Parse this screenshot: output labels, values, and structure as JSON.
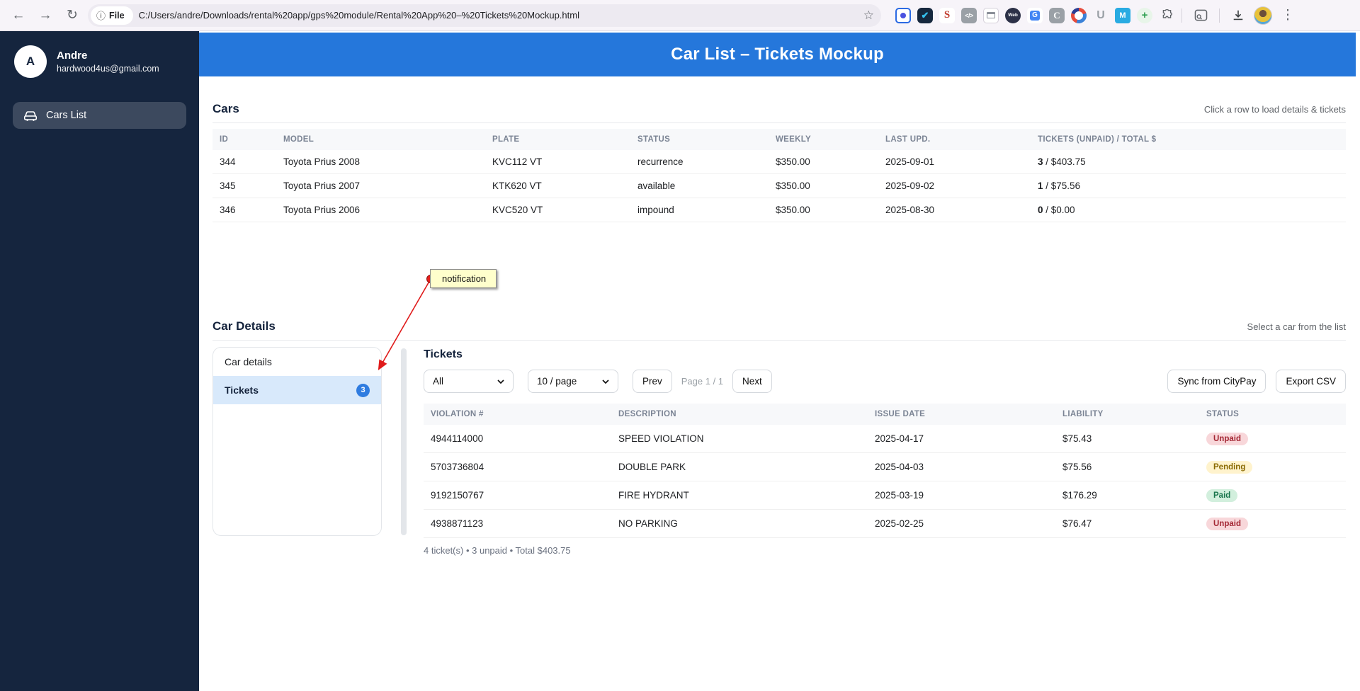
{
  "browser": {
    "scheme_chip": "File",
    "url": "C:/Users/andre/Downloads/rental%20app/gps%20module/Rental%20App%20–%20Tickets%20Mockup.html",
    "extensions": [
      {
        "name": "tab-capture-icon",
        "glyph": ""
      },
      {
        "name": "todo-check-icon",
        "glyph": "✔"
      },
      {
        "name": "seo-icon",
        "glyph": "S"
      },
      {
        "name": "code-icon",
        "glyph": "</>"
      },
      {
        "name": "screenshot-icon",
        "glyph": ""
      },
      {
        "name": "web-badge-icon",
        "glyph": "Web"
      },
      {
        "name": "translate-icon",
        "glyph": "G"
      },
      {
        "name": "c-icon",
        "glyph": "C"
      },
      {
        "name": "ring-icon",
        "glyph": ""
      },
      {
        "name": "u-icon",
        "glyph": "U"
      },
      {
        "name": "m-icon",
        "glyph": "M"
      },
      {
        "name": "plus-icon",
        "glyph": "+"
      },
      {
        "name": "puzzle-icon",
        "glyph": ""
      }
    ]
  },
  "sidebar": {
    "user": {
      "initial": "A",
      "name": "Andre",
      "email": "hardwood4us@gmail.com"
    },
    "items": [
      {
        "label": "Cars List"
      }
    ]
  },
  "header": {
    "title": "Car List – Tickets Mockup"
  },
  "cars": {
    "heading": "Cars",
    "hint": "Click a row to load details & tickets",
    "columns": [
      "ID",
      "MODEL",
      "PLATE",
      "STATUS",
      "WEEKLY",
      "LAST UPD.",
      "TICKETS (UNPAID) / TOTAL $"
    ],
    "tickets_separator": " / ",
    "rows": [
      {
        "id": "344",
        "model": "Toyota Prius 2008",
        "plate": "KVC112 VT",
        "status": "recurrence",
        "weekly": "$350.00",
        "last_upd": "2025-09-01",
        "tickets_unpaid": "3",
        "tickets_total": "$403.75"
      },
      {
        "id": "345",
        "model": "Toyota Prius 2007",
        "plate": "KTK620 VT",
        "status": "available",
        "weekly": "$350.00",
        "last_upd": "2025-09-02",
        "tickets_unpaid": "1",
        "tickets_total": "$75.56"
      },
      {
        "id": "346",
        "model": "Toyota Prius 2006",
        "plate": "KVC520 VT",
        "status": "impound",
        "weekly": "$350.00",
        "last_upd": "2025-08-30",
        "tickets_unpaid": "0",
        "tickets_total": "$0.00"
      }
    ]
  },
  "details": {
    "heading": "Car Details",
    "hint": "Select a car from the list",
    "tabs": [
      {
        "label": "Car details"
      },
      {
        "label": "Tickets",
        "badge": "3"
      }
    ]
  },
  "annotation": {
    "label": "notification"
  },
  "tickets": {
    "heading": "Tickets",
    "filter_value": "All",
    "page_size_value": "10 / page",
    "prev_label": "Prev",
    "page_indicator": "Page 1 / 1",
    "next_label": "Next",
    "sync_label": "Sync from CityPay",
    "export_label": "Export CSV",
    "columns": [
      "VIOLATION #",
      "DESCRIPTION",
      "ISSUE DATE",
      "LIABILITY",
      "STATUS"
    ],
    "rows": [
      {
        "violation": "4944114000",
        "description": "SPEED VIOLATION",
        "issue_date": "2025-04-17",
        "liability": "$75.43",
        "status": "Unpaid"
      },
      {
        "violation": "5703736804",
        "description": "DOUBLE PARK",
        "issue_date": "2025-04-03",
        "liability": "$75.56",
        "status": "Pending"
      },
      {
        "violation": "9192150767",
        "description": "FIRE HYDRANT",
        "issue_date": "2025-03-19",
        "liability": "$176.29",
        "status": "Paid"
      },
      {
        "violation": "4938871123",
        "description": "NO PARKING",
        "issue_date": "2025-02-25",
        "liability": "$76.47",
        "status": "Unpaid"
      }
    ],
    "summary": "4 ticket(s) • 3 unpaid • Total $403.75"
  },
  "colors": {
    "header_blue": "#2577db",
    "sidebar_navy": "#15253e",
    "badge_blue": "#2f7ce0",
    "selected_tab_bg": "#d8e9fb",
    "unpaid_bg": "#f8d7da",
    "unpaid_text": "#a32633",
    "pending_bg": "#fff3cd",
    "pending_text": "#8a6a04",
    "paid_bg": "#d2efdd",
    "paid_text": "#19754c",
    "annotation_bg": "#ffffcc",
    "annotation_arrow": "#e01b1b"
  }
}
